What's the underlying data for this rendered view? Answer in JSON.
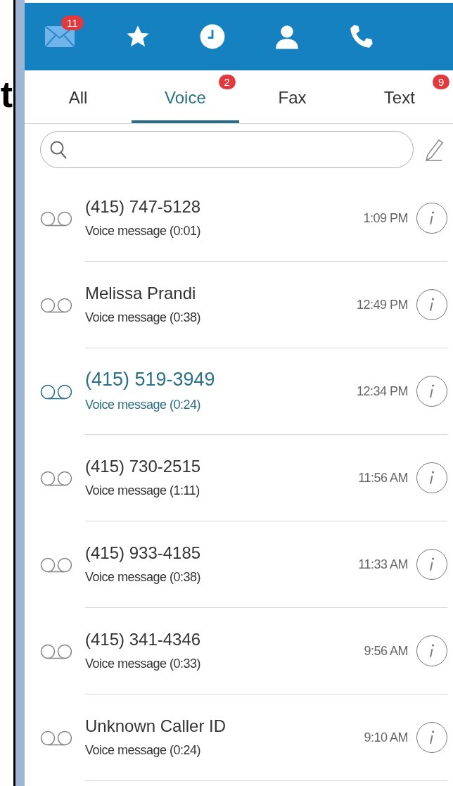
{
  "edge_text": "t",
  "toolbar": [
    {
      "kind": "mail",
      "badge": "11"
    },
    {
      "kind": "star"
    },
    {
      "kind": "clock"
    },
    {
      "kind": "person"
    },
    {
      "kind": "phone"
    }
  ],
  "tabs": [
    {
      "label": "All",
      "selected": false
    },
    {
      "label": "Voice",
      "selected": true,
      "badge": "2"
    },
    {
      "label": "Fax",
      "selected": false
    },
    {
      "label": "Text",
      "selected": false,
      "badge": "9"
    }
  ],
  "messages": [
    {
      "caller": "(415) 747-5128",
      "detail": "Voice message (0:01)",
      "time": "1:09 PM",
      "selected": false
    },
    {
      "caller": "Melissa Prandi",
      "detail": "Voice message (0:38)",
      "time": "12:49 PM",
      "selected": false
    },
    {
      "caller": "(415) 519-3949",
      "detail": "Voice message (0:24)",
      "time": "12:34 PM",
      "selected": true
    },
    {
      "caller": "(415) 730-2515",
      "detail": "Voice message (1:11)",
      "time": "11:56 AM",
      "selected": false
    },
    {
      "caller": "(415) 933-4185",
      "detail": "Voice message (0:38)",
      "time": "11:33 AM",
      "selected": false
    },
    {
      "caller": "(415) 341-4346",
      "detail": "Voice message (0:33)",
      "time": "9:56 AM",
      "selected": false
    },
    {
      "caller": "Unknown Caller ID",
      "detail": "Voice message (0:24)",
      "time": "9:10 AM",
      "selected": false
    }
  ]
}
